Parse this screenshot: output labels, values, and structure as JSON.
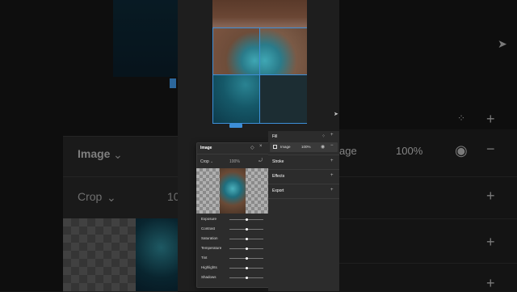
{
  "background": {
    "image_label": "Image",
    "crop_label": "Crop",
    "crop_value": "10",
    "fill_partial": "age",
    "fill_pct": "100%"
  },
  "image_panel": {
    "title": "Image",
    "mode": "Crop",
    "mode_pct": "100%",
    "adjustments": [
      {
        "label": "Exposure",
        "value": 0.5
      },
      {
        "label": "Contrast",
        "value": 0.5
      },
      {
        "label": "Saturation",
        "value": 0.5
      },
      {
        "label": "Temperature",
        "value": 0.5
      },
      {
        "label": "Tint",
        "value": 0.5
      },
      {
        "label": "Highlights",
        "value": 0.5
      },
      {
        "label": "Shadows",
        "value": 0.5
      }
    ]
  },
  "props": {
    "fill_title": "Fill",
    "fill_type": "Image",
    "fill_pct": "100%",
    "stroke": "Stroke",
    "effects": "Effects",
    "export": "Export"
  }
}
